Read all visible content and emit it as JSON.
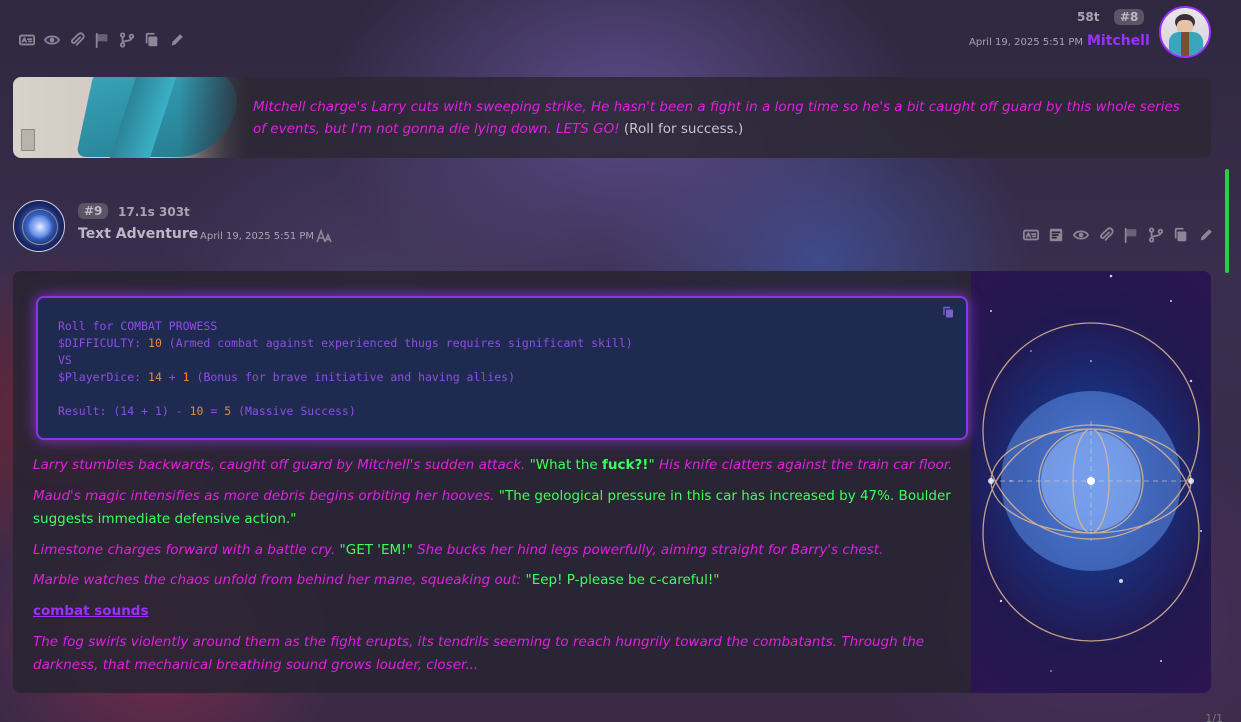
{
  "message8": {
    "tokens": "58t",
    "id": "#8",
    "timestamp": "April 19, 2025 5:51 PM",
    "author": "Mitchell",
    "text_italic": "Mitchell charge's Larry cuts with sweeping strike, He hasn't been a fight in a long time so he's a bit caught off guard by this whole series of events, but I'm not gonna die lying down. LETS GO!",
    "text_plain": "(Roll for success.)"
  },
  "message9": {
    "id": "#9",
    "gen_time": "17.1s",
    "tokens": "303t",
    "author": "Text Adventure",
    "timestamp": "April 19, 2025 5:51 PM",
    "code": {
      "line1": "Roll for COMBAT PROWESS",
      "l2_a": "$DIFFICULTY: ",
      "l2_n": "10",
      "l2_b": " (Armed combat against experienced thugs requires significant skill)",
      "line3": "VS",
      "l4_a": "$PlayerDice: ",
      "l4_n1": "14",
      "l4_b": " + ",
      "l4_n2": "1",
      "l4_c": " (Bonus for brave initiative and having allies)",
      "l6_a": "Result: (14 + 1) - ",
      "l6_n1": "10",
      "l6_b": " = ",
      "l6_n2": "5",
      "l6_c": " (Massive Success)"
    },
    "p1_italic": "Larry stumbles backwards, caught off guard by Mitchell's sudden attack.",
    "p1_q1": "\"What the ",
    "p1_q_bold": "fuck?!",
    "p1_q2": "\"",
    "p1_italic2": "His knife clatters against the train car floor.",
    "p2_italic": "Maud's magic intensifies as more debris begins orbiting her hooves.",
    "p2_q": "\"The geological pressure in this car has increased by 47%. Boulder suggests immediate defensive action.\"",
    "p3_italic1": "Limestone charges forward with a battle cry.",
    "p3_q": "\"GET 'EM!\"",
    "p3_italic2": "She bucks her hind legs powerfully, aiming straight for Barry's chest.",
    "p4_italic": "Marble watches the chaos unfold from behind her mane, squeaking out:",
    "p4_q": "\"Eep! P-please be c-careful!\"",
    "link": "combat sounds",
    "p5_italic": "The fog swirls violently around them as the fight erupts, its tendrils seeming to reach hungrily toward the combatants. Through the darkness, that mechanical breathing sound grows louder, closer..."
  },
  "pager": "1/1"
}
